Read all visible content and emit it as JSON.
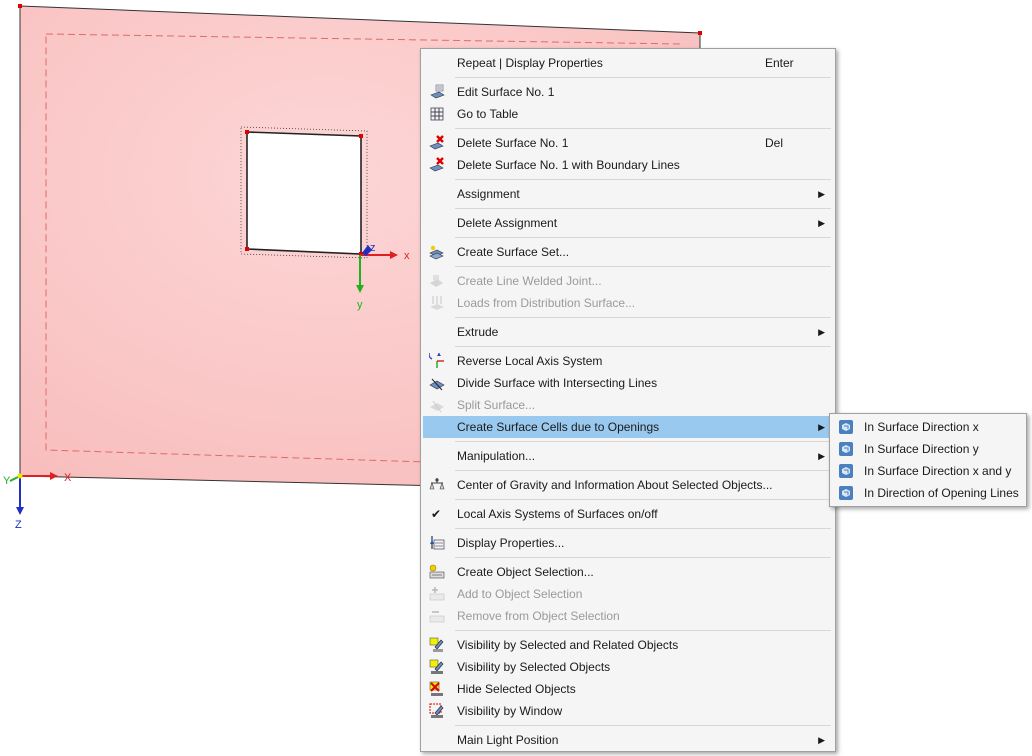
{
  "viewport": {
    "axes": {
      "x": "x",
      "y": "y",
      "z": "Z"
    },
    "global_axes": {
      "x": "X",
      "y": "Y",
      "z": "Z"
    }
  },
  "menu": {
    "items": [
      {
        "label": "Repeat | Display Properties",
        "shortcut": "Enter",
        "icon": "none",
        "enabled": true
      },
      {
        "sep": true
      },
      {
        "label": "Edit Surface No. 1",
        "icon": "edit-surface-icon",
        "enabled": true
      },
      {
        "label": "Go to Table",
        "icon": "table-icon",
        "enabled": true
      },
      {
        "sep": true
      },
      {
        "label": "Delete Surface No. 1",
        "shortcut": "Del",
        "icon": "delete-surface-icon",
        "enabled": true
      },
      {
        "label": "Delete Surface No. 1 with Boundary Lines",
        "icon": "delete-surface-icon",
        "enabled": true
      },
      {
        "sep": true
      },
      {
        "label": "Assignment",
        "submenu": true,
        "icon": "none",
        "enabled": true
      },
      {
        "sep": true
      },
      {
        "label": "Delete Assignment",
        "submenu": true,
        "icon": "none",
        "enabled": true
      },
      {
        "sep": true
      },
      {
        "label": "Create Surface Set...",
        "icon": "surface-set-icon",
        "enabled": true
      },
      {
        "sep": true
      },
      {
        "label": "Create Line Welded Joint...",
        "icon": "welded-joint-icon",
        "enabled": false
      },
      {
        "label": "Loads from Distribution Surface...",
        "icon": "load-distribution-icon",
        "enabled": false
      },
      {
        "sep": true
      },
      {
        "label": "Extrude",
        "submenu": true,
        "icon": "none",
        "enabled": true
      },
      {
        "sep": true
      },
      {
        "label": "Reverse Local Axis System",
        "icon": "reverse-axis-icon",
        "enabled": true
      },
      {
        "label": "Divide Surface with Intersecting Lines",
        "icon": "divide-surface-icon",
        "enabled": true
      },
      {
        "label": "Split Surface...",
        "icon": "split-surface-icon",
        "enabled": false
      },
      {
        "label": "Create Surface Cells due to Openings",
        "submenu": true,
        "icon": "none",
        "enabled": true,
        "active": true
      },
      {
        "sep": true
      },
      {
        "label": "Manipulation...",
        "submenu": true,
        "icon": "none",
        "enabled": true
      },
      {
        "sep": true
      },
      {
        "label": "Center of Gravity and Information About Selected Objects...",
        "icon": "center-gravity-icon",
        "enabled": true
      },
      {
        "sep": true
      },
      {
        "label": "Local Axis Systems of Surfaces on/off",
        "icon": "checkmark-icon",
        "enabled": true,
        "checked": true
      },
      {
        "sep": true
      },
      {
        "label": "Display Properties...",
        "icon": "display-properties-icon",
        "enabled": true
      },
      {
        "sep": true
      },
      {
        "label": "Create Object Selection...",
        "icon": "object-selection-icon",
        "enabled": true
      },
      {
        "label": "Add to Object Selection",
        "icon": "add-selection-icon",
        "enabled": false
      },
      {
        "label": "Remove from Object Selection",
        "icon": "remove-selection-icon",
        "enabled": false
      },
      {
        "sep": true
      },
      {
        "label": "Visibility by Selected and Related Objects",
        "icon": "visibility-related-icon",
        "enabled": true
      },
      {
        "label": "Visibility by Selected Objects",
        "icon": "visibility-selected-icon",
        "enabled": true
      },
      {
        "label": "Hide Selected Objects",
        "icon": "hide-objects-icon",
        "enabled": true
      },
      {
        "label": "Visibility by Window",
        "icon": "visibility-window-icon",
        "enabled": true
      },
      {
        "sep": true
      },
      {
        "label": "Main Light Position",
        "submenu": true,
        "icon": "none",
        "enabled": true
      }
    ]
  },
  "submenu": {
    "items": [
      {
        "label": "In Surface Direction x",
        "icon": "surface-cell-icon"
      },
      {
        "label": "In Surface Direction y",
        "icon": "surface-cell-icon"
      },
      {
        "label": "In Surface Direction x and y",
        "icon": "surface-cell-icon"
      },
      {
        "label": "In Direction of Opening Lines",
        "icon": "surface-cell-icon"
      }
    ]
  },
  "colors": {
    "surface_fill": "#fcc8c8",
    "surface_edge": "#333333",
    "dashed": "#e06a6a",
    "node": "#e00000",
    "axis_x": "#e02020",
    "axis_y": "#20b020",
    "axis_z": "#2030c0",
    "highlight": "#99c9ef"
  }
}
